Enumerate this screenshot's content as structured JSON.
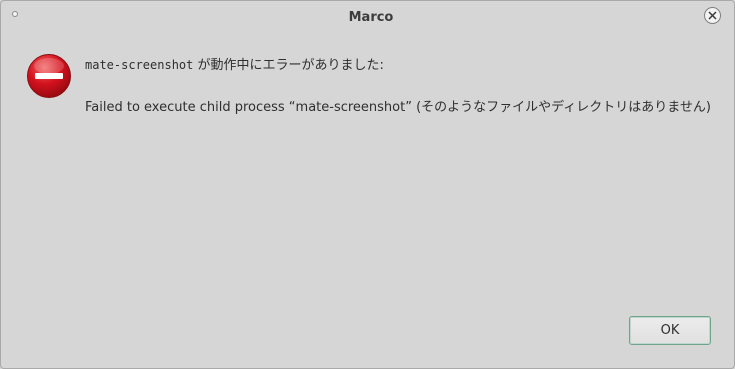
{
  "window": {
    "title": "Marco"
  },
  "dialog": {
    "command": "mate-screenshot",
    "primary_suffix": " が動作中にエラーがありました:",
    "secondary": "Failed to execute child process “mate-screenshot” (そのようなファイルやディレクトリはありません)",
    "icon": "dialog-error-icon"
  },
  "buttons": {
    "ok_label": "OK",
    "close_icon": "close-icon"
  },
  "colors": {
    "background": "#d6d6d6",
    "error_red": "#d3121e",
    "ok_border": "#6fa58c"
  }
}
